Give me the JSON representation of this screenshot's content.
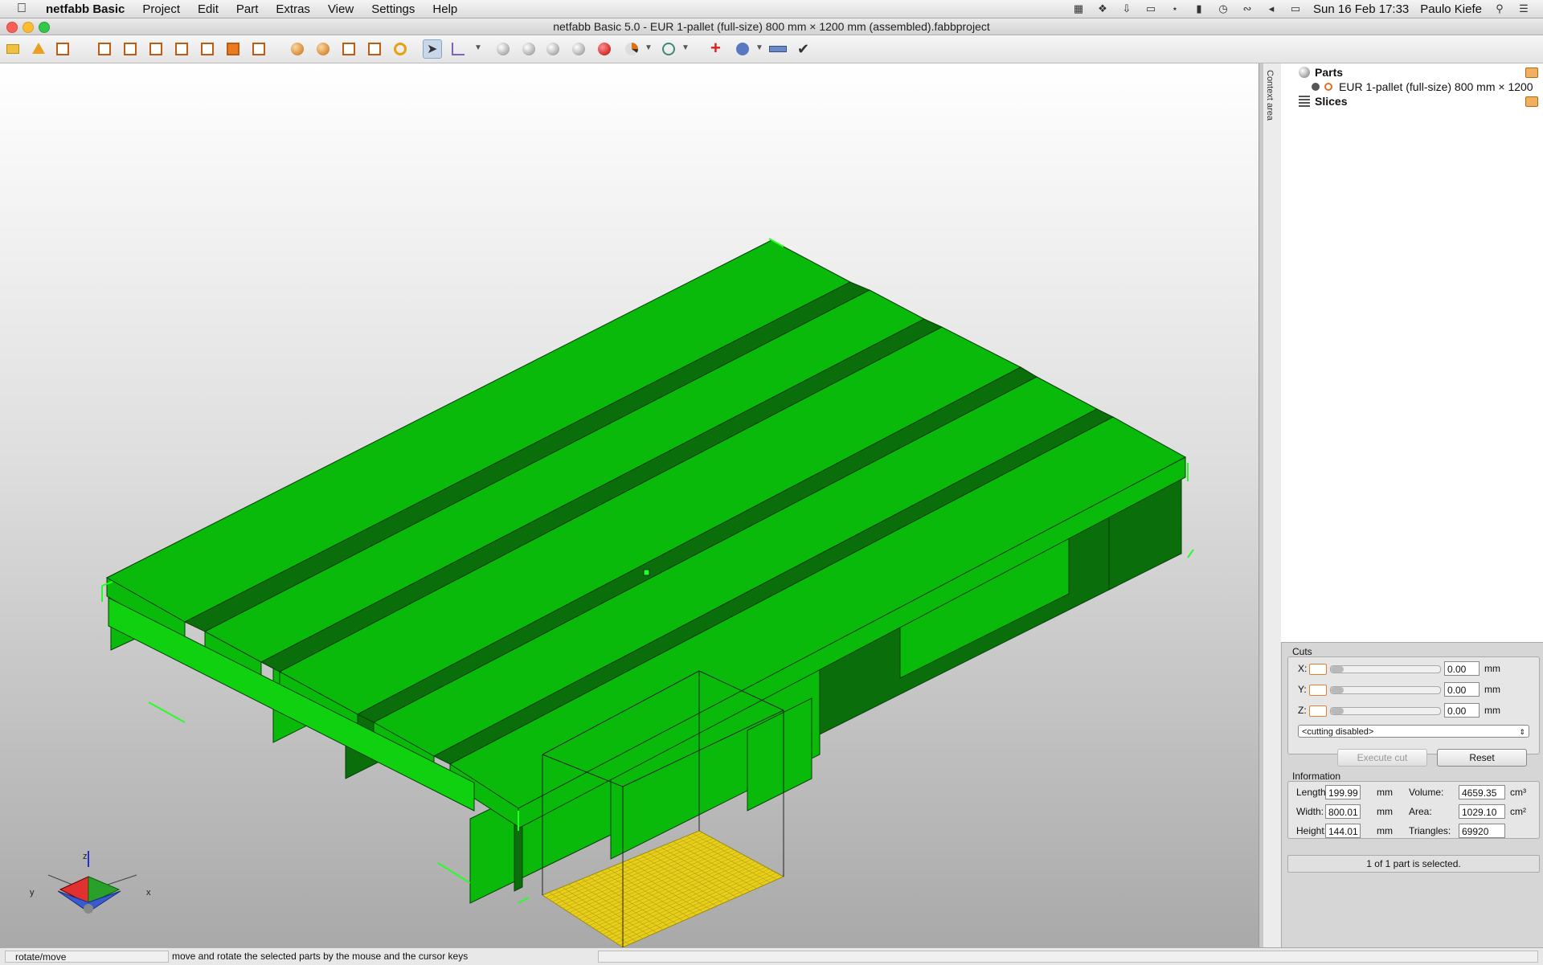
{
  "menubar": {
    "app_name": "netfabb Basic",
    "items": [
      "Project",
      "Edit",
      "Part",
      "Extras",
      "View",
      "Settings",
      "Help"
    ],
    "datetime": "Sun 16 Feb  17:33",
    "user": "Paulo Kiefe"
  },
  "window": {
    "title": "netfabb Basic 5.0 - EUR 1-pallet (full-size) 800 mm × 1200 mm (assembled).fabbproject"
  },
  "toolbar": {
    "active_tool": "select-arrow"
  },
  "viewport": {
    "model_color": "#0aba0a",
    "shade_color": "#0a6e0a",
    "slice_plane_color": "#e8cf1a",
    "background_top": "#ffffff",
    "background_bottom": "#a9a9a9",
    "axes": {
      "x": "x",
      "y": "y",
      "z": "z"
    }
  },
  "context_tab": {
    "label": "Context area"
  },
  "tree": {
    "parts_label": "Parts",
    "part_name": "EUR 1-pallet (full-size) 800 mm × 1200",
    "slices_label": "Slices"
  },
  "cuts": {
    "title": "Cuts",
    "x_label": "X:",
    "y_label": "Y:",
    "z_label": "Z:",
    "x_value": "0.00",
    "y_value": "0.00",
    "z_value": "0.00",
    "unit": "mm",
    "mode": "<cutting disabled>",
    "execute_label": "Execute cut",
    "reset_label": "Reset"
  },
  "information": {
    "title": "Information",
    "length_label": "Length:",
    "length_value": "199.99",
    "width_label": "Width:",
    "width_value": "800.01",
    "height_label": "Height:",
    "height_value": "144.01",
    "mm": "mm",
    "volume_label": "Volume:",
    "volume_value": "4659.35",
    "volume_unit": "cm³",
    "area_label": "Area:",
    "area_value": "1029.10",
    "area_unit": "cm²",
    "triangles_label": "Triangles:",
    "triangles_value": "69920",
    "selection_status": "1 of 1 part is selected."
  },
  "statusbar": {
    "mode": "rotate/move",
    "hint": "move and rotate the selected parts by the mouse and the cursor keys"
  }
}
